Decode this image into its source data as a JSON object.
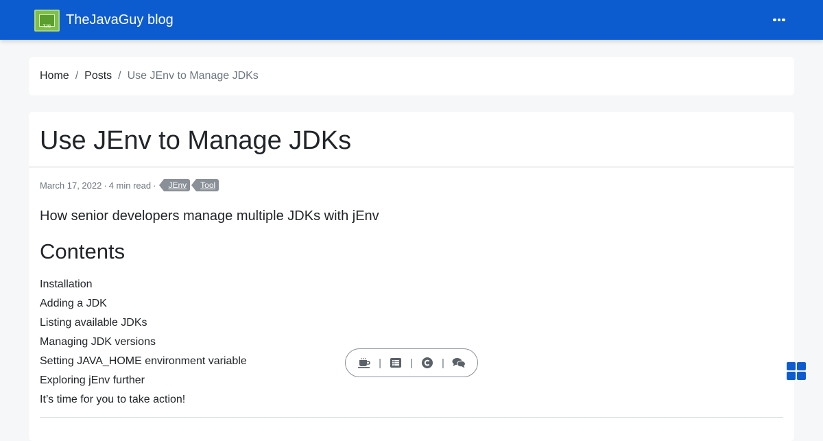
{
  "navbar": {
    "brand_name": "TheJavaGuy blog",
    "logo_text": "TJG",
    "more_icon": "ellipsis-icon",
    "color": "#0d5ccf"
  },
  "breadcrumb": {
    "items": [
      "Home",
      "Posts"
    ],
    "current": "Use JEnv to Manage JDKs",
    "separator": "/"
  },
  "article": {
    "title": "Use JEnv to Manage JDKs",
    "date": "March 17, 2022",
    "read_time": "4 min read",
    "meta_separator": "·",
    "tags": [
      "JEnv",
      "Tool"
    ],
    "summary": "How senior developers manage multiple JDKs with jEnv",
    "contents_heading": "Contents",
    "toc": [
      "Installation",
      "Adding a JDK",
      "Listing available JDKs",
      "Managing JDK versions",
      "Setting JAVA_HOME environment variable",
      "Exploring jEnv further",
      "It’s time for you to take action!"
    ]
  },
  "toolbar": {
    "separator": "|",
    "icons": [
      "coffee-icon",
      "list-icon",
      "copyright-icon",
      "comments-icon"
    ]
  },
  "fab": {
    "icon": "grid-icon",
    "color": "#0d5ccf"
  }
}
